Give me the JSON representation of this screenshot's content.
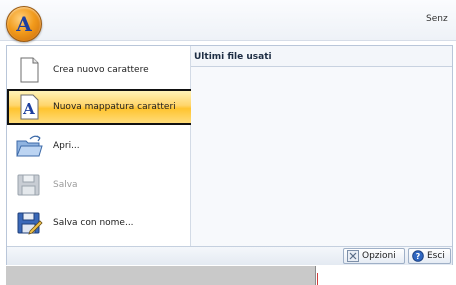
{
  "window": {
    "title": "Senz"
  },
  "menu": {
    "items": [
      {
        "label": "Crea nuovo carattere",
        "icon": "new-document-icon",
        "state": "normal"
      },
      {
        "label": "Nuova mappatura caratteri",
        "icon": "font-mapping-icon",
        "state": "selected"
      },
      {
        "label": "Apri...",
        "icon": "open-folder-icon",
        "state": "normal"
      },
      {
        "label": "Salva",
        "icon": "save-icon",
        "state": "disabled"
      },
      {
        "label": "Salva con nome...",
        "icon": "save-as-icon",
        "state": "normal"
      }
    ]
  },
  "recent": {
    "header": "Ultimi file usati"
  },
  "footer": {
    "options_label": "Opzioni",
    "exit_label": "Esci"
  },
  "colors": {
    "selected_start": "#fff3b8",
    "selected_end": "#ffc42f",
    "app_button": "#f29b1c"
  }
}
